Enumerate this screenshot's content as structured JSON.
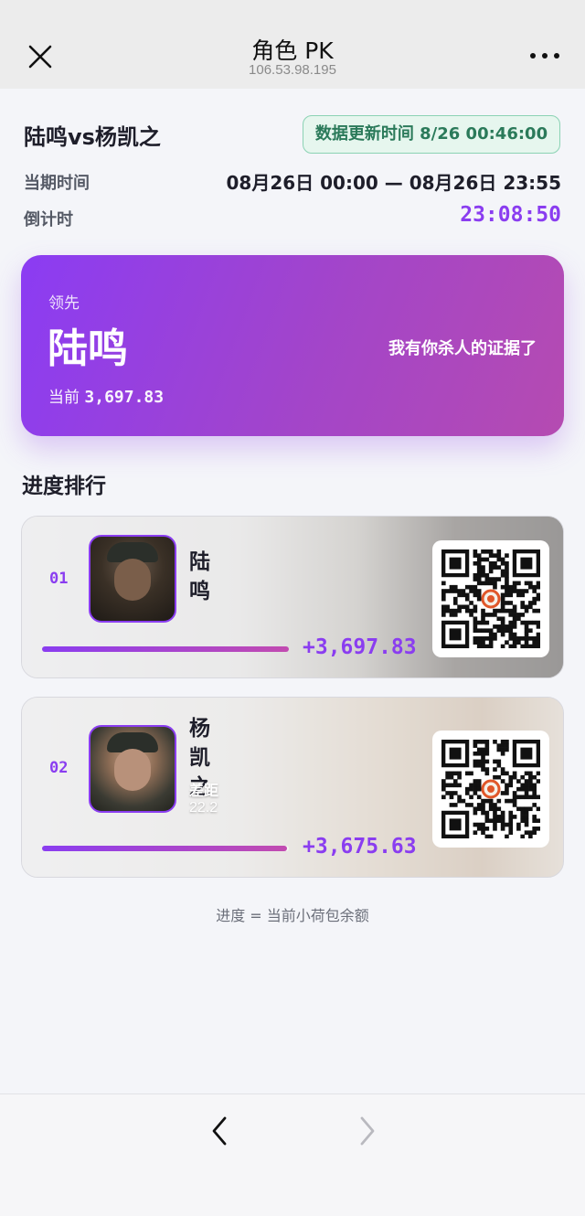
{
  "header": {
    "title": "角色 PK",
    "subtitle": "106.53.98.195"
  },
  "match": {
    "title": "陆鸣vs杨凯之",
    "update_badge": "数据更新时间 8/26 00:46:00",
    "period_label": "当期时间",
    "period_value": "08月26日 00:00 — 08月26日 23:55",
    "countdown_label": "倒计时",
    "countdown_value": "23:08:50"
  },
  "leader": {
    "label": "领先",
    "name": "陆鸣",
    "quote": "我有你杀人的证据了",
    "current_label": "当前",
    "current_value": "3,697.83"
  },
  "ranking": {
    "title": "进度排行",
    "items": [
      {
        "rank": "01",
        "name": "陆鸣",
        "score": "+3,697.83",
        "progress": 1.0
      },
      {
        "rank": "02",
        "name": "杨凯之",
        "gap_label": "差距",
        "gap_value": "22.2",
        "score": "+3,675.63",
        "progress": 0.994
      }
    ],
    "footnote": "进度 = 当前小荷包余额"
  },
  "colors": {
    "accent": "#8a3df0",
    "accent_pink": "#c24bb0",
    "badge_green": "#2b7a5a"
  },
  "icons": {
    "close": "close-icon",
    "more": "more-icon",
    "back": "chevron-left-icon",
    "forward": "chevron-right-icon"
  }
}
